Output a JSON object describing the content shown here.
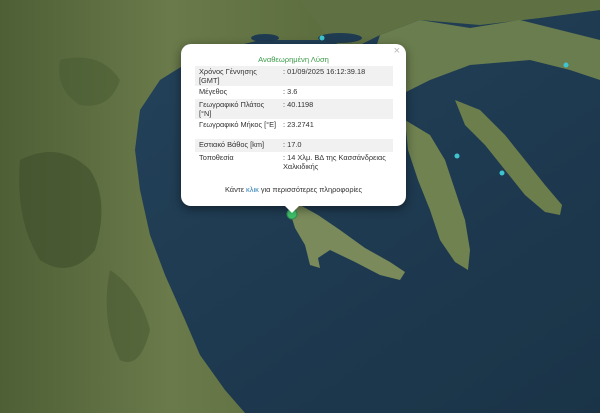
{
  "popup": {
    "title": "Αναθεωρημένη Λύση",
    "close_symbol": "×",
    "rows": [
      {
        "label": "Χρόνος Γέννησης [GMT]",
        "value": ": 01/09/2025 16:12:39.18"
      },
      {
        "label": "Μέγεθος",
        "value": ": 3.6"
      },
      {
        "label": "Γεωγραφικό Πλάτος [°N]",
        "value": ": 40.1198"
      },
      {
        "label": "Γεωγραφικό Μήκος [°E]",
        "value": ": 23.2741"
      },
      {
        "label": "Εστιακό Βάθος [km]",
        "value": ": 17.0"
      },
      {
        "label": "Τοποθεσία",
        "value": ": 14 Χλμ. ΒΔ της Κασσάνδρειας Χαλκιδικής"
      }
    ],
    "footer_before": "Κάντε ",
    "footer_link": "κλικ",
    "footer_after": " για περισσότερες πληροφορίες"
  },
  "colors": {
    "sea": "#1f3b52",
    "land": "#566b3c",
    "epicenter_marker": "#3fbf6a",
    "other_events": "#3ec4cf",
    "title_green": "#3c9b4a",
    "link_blue": "#2a7fb8"
  },
  "markers": {
    "epicenter": "green-circle",
    "other_events": "cyan-dots"
  }
}
